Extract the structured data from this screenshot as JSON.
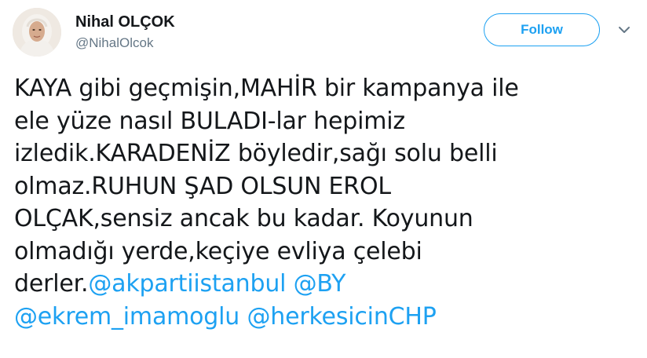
{
  "user": {
    "display_name": "Nihal OLÇOK",
    "handle": "@NihalOlcok"
  },
  "follow_button": {
    "label": "Follow"
  },
  "tweet": {
    "lines": [
      "KAYA gibi geçmişin,MAHİR bir kampanya ile",
      "ele yüze nasıl BULADI-lar hepimiz",
      "izledik.KARADENİZ böyledir,sağı solu belli",
      "olmaz.RUHUN ŞAD OLSUN EROL",
      "OLÇAK,sensiz ancak bu kadar. Koyunun",
      "olmadığı yerde,keçiye evliya çelebi",
      "derler."
    ],
    "mentions": {
      "akparti": "@akpartiistanbul",
      "by": "@BY",
      "ekrem": "@ekrem_imamoglu",
      "herkes": "@herkesicinCHP"
    }
  },
  "colors": {
    "link": "#1da1f2",
    "text": "#14171a",
    "secondary": "#657786"
  },
  "icons": {
    "caret": "chevron-down-icon",
    "avatar": "avatar"
  }
}
